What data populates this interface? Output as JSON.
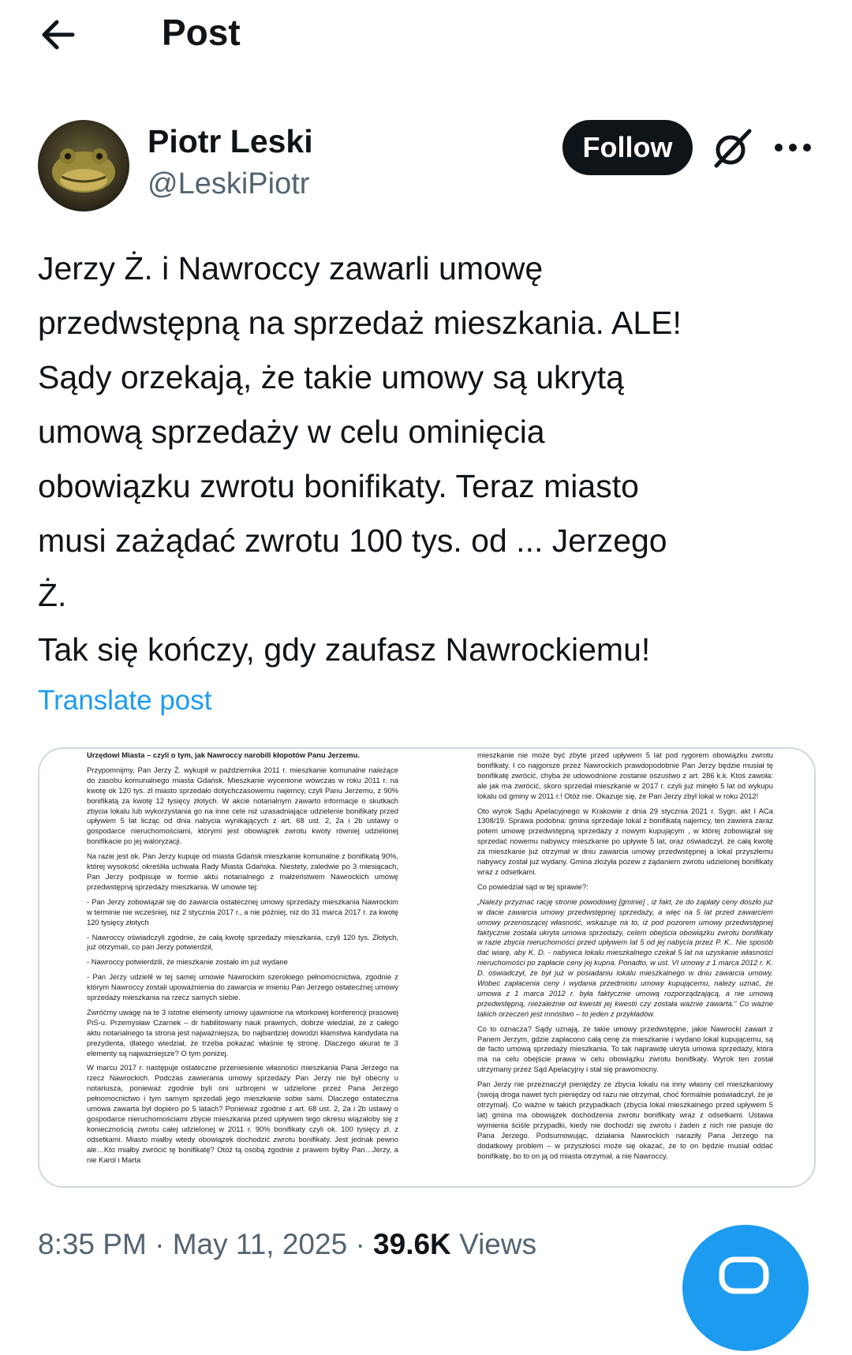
{
  "header": {
    "title": "Post"
  },
  "author": {
    "name": "Piotr Leski",
    "handle": "@LeskiPiotr",
    "follow_label": "Follow"
  },
  "tweet": {
    "text": "Jerzy Ż. i Nawroccy zawarli umowę\nprzedwstępną na sprzedaż mieszkania. ALE!\nSądy orzekają, że takie umowy są ukrytą\numową sprzedaży w celu ominięcia\nobowiązku zwrotu bonifikaty. Teraz miasto\nmusi zażądać zwrotu 100 tys. od ... Jerzego\nŻ.\nTak się kończy, gdy zaufasz Nawrockiemu!",
    "translate_label": "Translate post"
  },
  "document": {
    "left_paragraphs": [
      "Urzędowi Miasta – czyli o tym, jak Nawroccy narobili kłopotów Panu Jerzemu.",
      "Przypomnijmy, Pan Jerzy Ż. wykupił w października 2011 r. mieszkanie komunalne należące do zasobu komunalnego miasta Gdańsk. Mieszkanie wycenione wówczas w roku 2011 r. na kwotę ok 120 tys. zł miasto sprzedało dotychczasowemu najemcy, czyli Panu Jerzemu, z 90% bonifikatą za kwotę 12 tysięcy złotych. W akcie notarialnym zawarto informacje o skutkach zbycia lokalu lub wykorzystania go na inne cele niż uzasadniające udzielenie bonifikaty przed upływem 5 lat licząc od dnia nabycia wynikających z art. 68 ust. 2, 2a i 2b ustawy o gospodarce nieruchomościami, którymi jest obowiązek zwrotu kwoty równiej udzielonej bonifikacie po jej waloryzacji.",
      "Na razie jest ok. Pan Jerzy kupuje od miasta Gdańsk mieszkanie komunalne z bonifikatą 90%, której wysokość określiła uchwała Rady Miasta Gdańska. Niestety, zaledwie po 3 miesiącach, Pan Jerzy podpisuje w formie aktu notarialnego z małżeństwem Nawrockich umowę przedwstępną sprzedaży mieszkania. W umowie tej:",
      "- Pan Jerzy zobowiązał się do zawarcia ostatecznej umowy sprzedaży mieszkania Nawrockim w terminie nie wcześniej, niż 2 stycznia 2017 r., a nie później, niż do 31 marca 2017 r. za kwotę 120 tysięcy złotych",
      "- Nawroccy oświadczyli zgodnie, że całą kwotę sprzedaży mieszkania, czyli 120 tys. Złotych, już otrzymali, co pan Jerzy potwierdził,",
      "- Nawroccy potwierdzili, że mieszkanie zostało im już wydane",
      "- Pan Jerzy udzielił w tej samej umowie Nawrockim szerokiego pełnomocnictwa, zgodnie z którym Nawroccy zostali upoważnienia do zawarcia w imieniu Pan Jerzego ostatecznej umowy sprzedaży mieszkania na rzecz samych siebie.",
      "Zwróćmy uwagę na te 3 istotne elementy umowy ujawnione na wtorkowej konferencji prasowej PiS-u. Przemysław Czarnek – dr habilitowany nauk prawnych, dobrze wiedział, że z całego aktu notarialnego ta strona jest najważniejsza, bo najbardziej dowodzi kłamstwa kandydata na prezydenta, dlatego wiedział, że trzeba pokazać właśnie tę stronę. Dlaczego akurat te 3 elementy są najważniejsze? O tym poniżej.",
      "W marcu 2017 r. następuje ostateczne przeniesienie własności mieszkania Pana Jerzego na rzecz Nawrockich. Podczas zawierania umowy sprzedaży Pan Jerzy nie był obecny u notariusza, ponieważ zgodnie byli oni uzbrojeni w udzielone przez Pana Jerzego pełnomocnictwo i tym samym sprzedali jego mieszkanie sobie sami. Dlaczego ostateczna umowa zawarta był dopiero po 5 latach? Ponieważ zgodnie z art. 68 ust. 2, 2a i 2b ustawy o gospodarce nieruchomościami zbycie mieszkania przed upływem tego okresu wiązałoby się z koniecznością zwrotu całej udzielonej w 2011 r. 90% bonifikaty czyli ok. 100 tysięcy zł. z odsetkami. Miasto miałby wtedy obowiązek dochodzić zwrotu bonifikaty. Jest jednak pewno ale…Kto miałby zwrócić tę bonifikatę? Otóż tą osobą zgodnie z prawem byłby Pan…Jerzy, a nie Karol i Marta"
    ],
    "right_paragraphs": [
      "mieszkanie nie może być zbyte przed upływem 5 lat pod rygorem obowiązku zwrotu bonifikaty. I co najgorsze przez Nawrockich prawdopodobnie Pan Jerzy będzie musiał tę bonifikatę zwrócić, chyba że udowodnione zostanie oszustwo z art. 286 k.k. Ktoś zawoła: ale jak ma zwrócić, skoro sprzedał mieszkanie w 2017 r. czyli już minęło 5 lat od wykupu lokalu od gminy w 2011 r.! Otóż nie. Okazuje się, że Pan Jerzy zbył lokal w roku 2012!",
      "Oto wyrok Sądu Apelacyjnego w Krakowie z dnia 29 stycznia 2021 r. Sygn. akt I ACa 1308/19. Sprawa podobna: gmina sprzedaje lokal z bonifikatą najemcy, ten zawiera zaraz potem umowę przedwstępną sprzedaży z nowym kupującym , w której zobowiązał się sprzedać nowemu nabywcy mieszkanie po upływie 5 lat, oraz oświadczył, że całą kwotę za mieszkanie już otrzymał w dniu zawarcia umowy przedwstępnej a lokal przyszłemu nabywcy został już wydany. Gmina złożyła pozew z żądaniem zwrotu udzielonej bonifikaty wraz z odsetkami.",
      "Co powiedział sąd w tej sprawie?:",
      "„Należy przyznać rację stronie powodowej [gminie] , iż fakt, że do zapłaty ceny doszło już w dacie zawarcia umowy przedwstępnej sprzedaży, a więc na 5 lat przed zawarciem umowy przenoszącej własność, wskazuje na to, iż pod pozorem umowy przedwstępnej faktycznie została ukryta umowa sprzedaży, celem obejścia obowiązku zwrotu bonifikaty w razie zbycia nieruchomości przed upływem lat 5 od jej nabycia przez P. K.. Nie sposób dać wiarę, aby K. D. - nabywca lokalu mieszkalnego czekał 5 lat na uzyskanie własności nieruchomości po zapłacie ceny jej kupna. Ponadto, w ust. VI umowy z 1 marca 2012 r. K. D. oświadczył, że był już w posiadaniu lokalu mieszkalnego w dniu zawarcia umowy. Wobec zapłacenia ceny i wydania przedmiotu umowy kupującemu, należy uznać, że umowa z 1 marca 2012 r. była faktycznie umową rozporządzającą, a nie umową przedwstępną, niezależnie od kwestii jej kwestii czy została ważnie zawarta.” Co ważne takich orzeczeń jest mnóstwo – to jeden z przykładów.",
      "Co to oznacza? Sądy uznają, że takie umowy przedwstępne, jakie Nawrocki zawarł z Panem Jerzym, gdzie zapłacono całą cenę za mieszkanie i wydano lokal kupującemu, są de facto umową sprzedaży mieszkania. To tak naprawdę ukryta umowa sprzedaży, która ma na celu obejście prawa w celu obowiązku zwrotu bonifikaty. Wyrok ten został utrzymany przez Sąd Apelacyjny i stał się prawomocny.",
      "Pan Jerzy nie przeznaczył pieniędzy ze zbycia lokalu na inny własny cel mieszkaniowy (swoją droga nawet tych pieniędzy od razu nie otrzymał, choć formalnie poświadczył, że je otrzymał). Co ważne w takich przypadkach (zbycia lokal mieszkalnego przed upływem 5 lat) gmina ma obowiązek dochodzenia zwrotu bonifikaty wraz z odsetkami. Ustawa wymienia ściśle przypadki, kiedy nie dochodzi się zwrotu i żaden z nich nie pasuje do Pana Jerzego. Podsumowując, działania Nawrockich naraziły Pana Jerzego na dodatkowy problem – w przyszłości może się okazać, że to on będzie musiał oddać bonifikatę, bo to on ją od miasta otrzymał, a nie Nawroccy."
    ]
  },
  "meta": {
    "time": "8:35 PM",
    "date": "May 11, 2025",
    "views_count": "39.6K",
    "views_label": "Views",
    "separator": "·"
  },
  "colors": {
    "link": "#1d9bf0",
    "secondary": "#536471",
    "primary": "#0f1419",
    "doc_red": "#c0192c"
  },
  "icons": [
    "back-arrow-icon",
    "grok-icon",
    "more-icon",
    "compose-icon"
  ]
}
